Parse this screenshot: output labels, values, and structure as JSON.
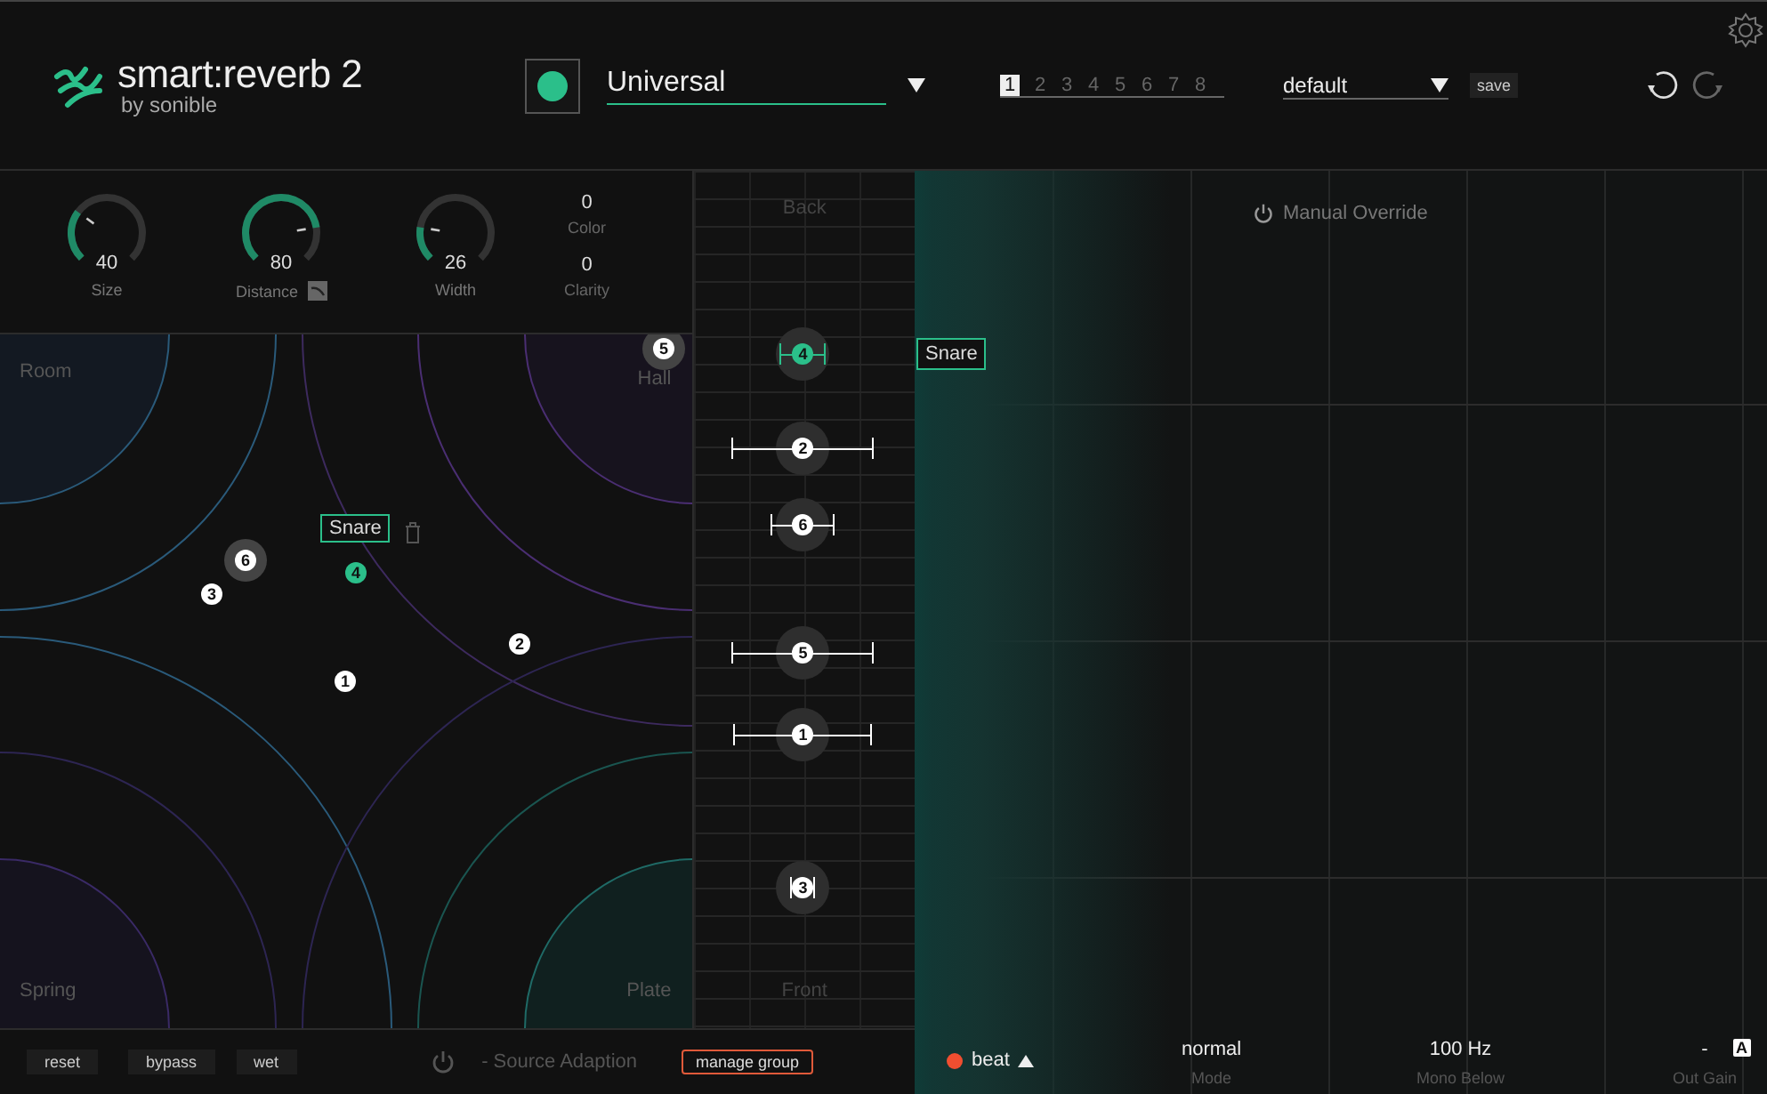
{
  "header": {
    "logo_title": "smart:reverb 2",
    "logo_byline": "by sonible",
    "profile_name": "Universal",
    "slots": [
      {
        "label": "1",
        "selected": true
      },
      {
        "label": "2",
        "selected": false
      },
      {
        "label": "3",
        "selected": false
      },
      {
        "label": "4",
        "selected": false
      },
      {
        "label": "5",
        "selected": false
      },
      {
        "label": "6",
        "selected": false
      },
      {
        "label": "7",
        "selected": false
      },
      {
        "label": "8",
        "selected": false
      }
    ],
    "preset": "default",
    "save": "save"
  },
  "knobs": [
    {
      "label": "Size",
      "value": "40",
      "level": 0.3
    },
    {
      "label": "Distance",
      "value": "80",
      "level": 0.8
    },
    {
      "label": "Width",
      "value": "26",
      "level": 0.2
    }
  ],
  "params": [
    {
      "label": "Color",
      "value": "0"
    },
    {
      "label": "Clarity",
      "value": "0"
    }
  ],
  "room": {
    "corners": [
      "Room",
      "Hall",
      "Spring",
      "Plate"
    ],
    "tag": "Snare"
  },
  "sources": [
    {
      "num": "1",
      "selected": false,
      "halo": false
    },
    {
      "num": "2",
      "selected": false,
      "halo": false
    },
    {
      "num": "3",
      "selected": false,
      "halo": false
    },
    {
      "num": "4",
      "selected": true,
      "halo": false
    },
    {
      "num": "5",
      "selected": false,
      "halo": true
    },
    {
      "num": "6",
      "selected": false,
      "halo": true
    }
  ],
  "depth": {
    "back": "Back",
    "front": "Front",
    "markers": [
      {
        "num": "4",
        "selected": true,
        "halo": true
      },
      {
        "num": "2",
        "selected": false,
        "halo": true
      },
      {
        "num": "6",
        "selected": false,
        "halo": true
      },
      {
        "num": "5",
        "selected": false,
        "halo": true
      },
      {
        "num": "1",
        "selected": false,
        "halo": true
      },
      {
        "num": "3",
        "selected": false,
        "halo": true
      }
    ]
  },
  "spectrum": {
    "override": "Manual Override",
    "tag": "Snare"
  },
  "footer": {
    "buttons": [
      "reset",
      "bypass",
      "wet"
    ],
    "adaption": "- Source Adaption",
    "manage": "manage group",
    "beat": "beat",
    "readouts": [
      {
        "value": "normal",
        "label": "Mode"
      },
      {
        "value": "100 Hz",
        "label": "Mono Below"
      },
      {
        "value": "-",
        "label": "Out Gain"
      }
    ],
    "auto": "A"
  }
}
